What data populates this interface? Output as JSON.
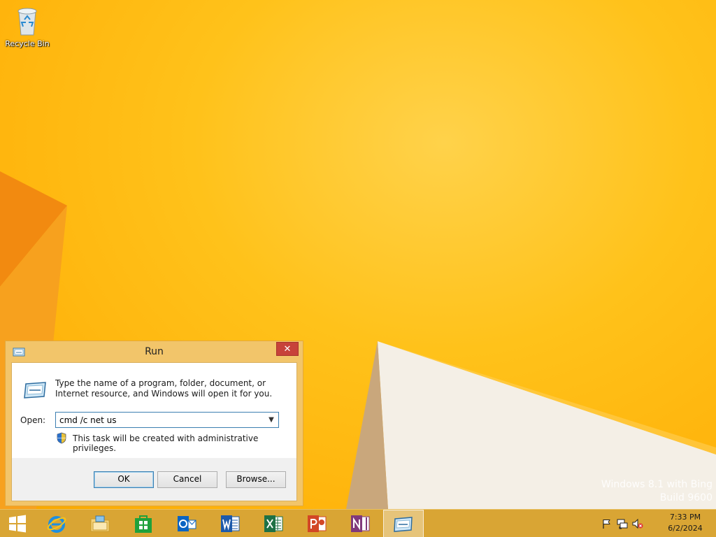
{
  "desktop": {
    "icons": [
      {
        "label": "Recycle Bin",
        "icon": "recycle-bin-icon"
      }
    ],
    "watermark": {
      "line1": "Windows 8.1 with Bing",
      "line2": "Build 9600"
    }
  },
  "run_dialog": {
    "title": "Run",
    "close_label": "✕",
    "description": "Type the name of a program, folder, document, or Internet resource, and Windows will open it for you.",
    "open_label": "Open:",
    "open_value": "cmd /c net us",
    "admin_note": "This task will be created with administrative privileges.",
    "buttons": {
      "ok": "OK",
      "cancel": "Cancel",
      "browse": "Browse..."
    }
  },
  "taskbar": {
    "items": [
      {
        "name": "start",
        "icon": "windows-logo-icon"
      },
      {
        "name": "internet-explorer",
        "icon": "internet-explorer-icon"
      },
      {
        "name": "file-explorer",
        "icon": "folder-icon"
      },
      {
        "name": "store",
        "icon": "store-icon"
      },
      {
        "name": "outlook",
        "icon": "outlook-icon"
      },
      {
        "name": "word",
        "icon": "word-icon"
      },
      {
        "name": "excel",
        "icon": "excel-icon"
      },
      {
        "name": "powerpoint",
        "icon": "powerpoint-icon"
      },
      {
        "name": "onenote",
        "icon": "onenote-icon"
      },
      {
        "name": "run",
        "icon": "run-icon",
        "active": true
      }
    ],
    "tray_icons": [
      "flag-icon",
      "network-icon",
      "volume-muted-icon"
    ],
    "clock": {
      "time": "7:33 PM",
      "date": "6/2/2024"
    }
  },
  "colors": {
    "accent": "#3c7fb1",
    "close": "#c7423a",
    "taskbar": "#d9a534",
    "frame": "#f2c56a"
  }
}
